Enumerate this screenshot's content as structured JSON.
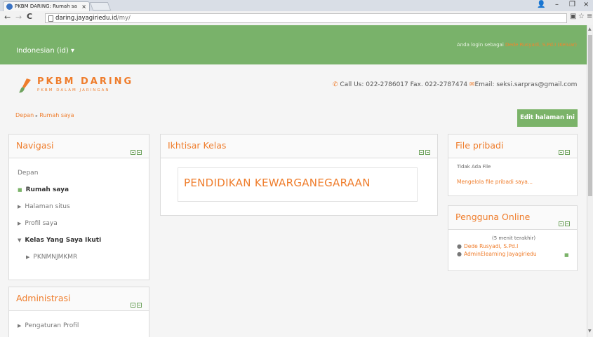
{
  "browser": {
    "tab_title": "PKBM DARING: Rumah sa",
    "tab_close": "×",
    "url_host": "daring.jayagiriedu.id",
    "url_path": "/my/",
    "min": "–",
    "max": "❐",
    "close": "×"
  },
  "header": {
    "language": "Indonesian (id) ▾",
    "login_prefix": "Anda login sebagai",
    "login_user": "Dede Rusyadi, S.Pd.I",
    "logout": "(Keluar)"
  },
  "brand": {
    "title": "PKBM DARING",
    "subtitle": "PKBM DALAM JARINGAN",
    "accent": "#ef7d2c",
    "green": "#79b26a"
  },
  "contact": {
    "phone": "Call Us: 022-2786017 Fax. 022-2787474",
    "email": "Email: seksi.sarpras@gmail.com"
  },
  "breadcrumb": {
    "home": "Depan",
    "current": "Rumah saya"
  },
  "edit_button": "Edit halaman ini",
  "navigasi": {
    "title": "Navigasi",
    "items": [
      "Depan",
      "Rumah saya",
      "Halaman situs",
      "Profil saya",
      "Kelas Yang Saya Ikuti",
      "PKNMNJMKMR"
    ]
  },
  "ikhtisar": {
    "title": "Ikhtisar Kelas",
    "course": "PENDIDIKAN KEWARGANEGARAAN"
  },
  "file_pribadi": {
    "title": "File pribadi",
    "empty": "Tidak Ada File",
    "manage": "Mengelola file pribadi saya..."
  },
  "pengguna_online": {
    "title": "Pengguna Online",
    "window": "(5 menit terakhir)",
    "users": [
      "Dede Rusyadi, S.Pd.I",
      "AdminElearning Jayagiriedu"
    ]
  },
  "administrasi": {
    "title": "Administrasi",
    "items": [
      "Pengaturan Profil"
    ]
  }
}
